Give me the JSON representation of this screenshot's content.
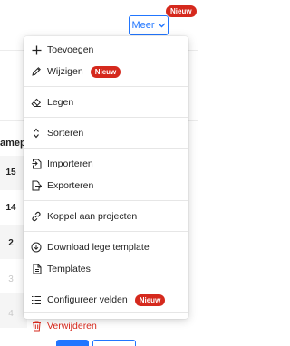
{
  "header": {
    "meer_label": "Meer",
    "meer_badge": "Nieuw"
  },
  "table": {
    "column_header": "amepu",
    "cells": [
      "15",
      "14",
      "2",
      "3",
      "4"
    ]
  },
  "menu": {
    "items": [
      {
        "label": "Toevoegen",
        "icon": "plus-icon"
      },
      {
        "label": "Wijzigen",
        "icon": "pencil-icon",
        "badge": "Nieuw"
      },
      {
        "label": "Legen",
        "icon": "eraser-icon"
      },
      {
        "label": "Sorteren",
        "icon": "sort-icon"
      },
      {
        "label": "Importeren",
        "icon": "import-icon"
      },
      {
        "label": "Exporteren",
        "icon": "export-icon"
      },
      {
        "label": "Koppel aan projecten",
        "icon": "link-icon"
      },
      {
        "label": "Download lege template",
        "icon": "download-icon"
      },
      {
        "label": "Templates",
        "icon": "template-icon"
      },
      {
        "label": "Configureer velden",
        "icon": "list-config-icon",
        "badge": "Nieuw"
      },
      {
        "label": "Verwijderen",
        "icon": "trash-icon"
      }
    ]
  },
  "colors": {
    "accent": "#2176ff",
    "badge": "#d5291d",
    "danger": "#d5291d"
  }
}
